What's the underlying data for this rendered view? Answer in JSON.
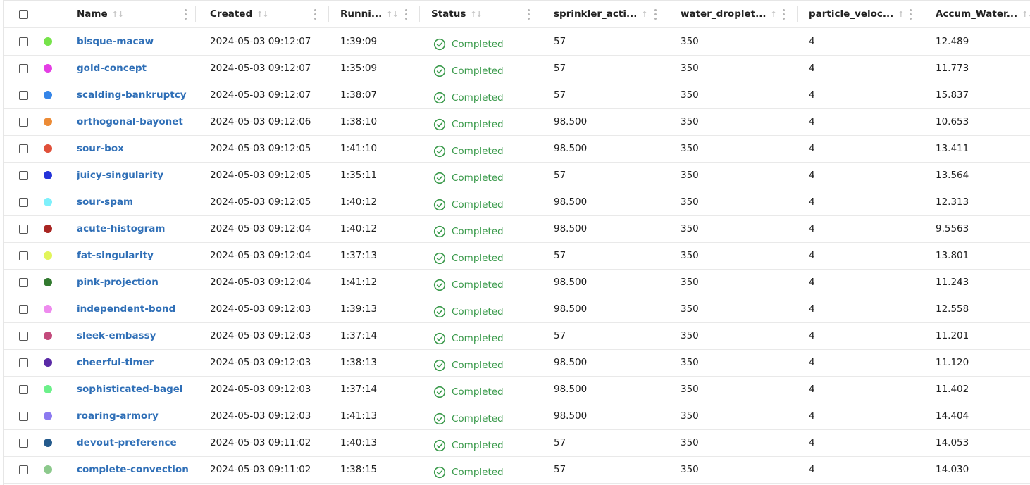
{
  "columns": {
    "name": "Name",
    "created": "Created",
    "running": "Runni...",
    "status": "Status",
    "sprinkler": "sprinkler_acti...",
    "water": "water_droplet...",
    "particle": "particle_veloc...",
    "accum": "Accum_Water..."
  },
  "icons": {
    "sort": "sort-icon",
    "menu": "column-menu-icon",
    "status": "check-circle-icon"
  },
  "colors": {
    "link": "#2f6fb7",
    "status_completed": "#3a9a4b"
  },
  "rows": [
    {
      "color": "#76e34a",
      "name": "bisque-macaw",
      "created": "2024-05-03 09:12:07",
      "running": "1:39:09",
      "status": "Completed",
      "sprinkler": "57",
      "water": "350",
      "particle": "4",
      "accum": "12.489"
    },
    {
      "color": "#e43ee4",
      "name": "gold-concept",
      "created": "2024-05-03 09:12:07",
      "running": "1:35:09",
      "status": "Completed",
      "sprinkler": "57",
      "water": "350",
      "particle": "4",
      "accum": "11.773"
    },
    {
      "color": "#3585e8",
      "name": "scalding-bankruptcy",
      "created": "2024-05-03 09:12:07",
      "running": "1:38:07",
      "status": "Completed",
      "sprinkler": "57",
      "water": "350",
      "particle": "4",
      "accum": "15.837"
    },
    {
      "color": "#ec8b36",
      "name": "orthogonal-bayonet",
      "created": "2024-05-03 09:12:06",
      "running": "1:38:10",
      "status": "Completed",
      "sprinkler": "98.500",
      "water": "350",
      "particle": "4",
      "accum": "10.653"
    },
    {
      "color": "#e0503a",
      "name": "sour-box",
      "created": "2024-05-03 09:12:05",
      "running": "1:41:10",
      "status": "Completed",
      "sprinkler": "98.500",
      "water": "350",
      "particle": "4",
      "accum": "13.411"
    },
    {
      "color": "#2433d9",
      "name": "juicy-singularity",
      "created": "2024-05-03 09:12:05",
      "running": "1:35:11",
      "status": "Completed",
      "sprinkler": "57",
      "water": "350",
      "particle": "4",
      "accum": "13.564"
    },
    {
      "color": "#7ef0fb",
      "name": "sour-spam",
      "created": "2024-05-03 09:12:05",
      "running": "1:40:12",
      "status": "Completed",
      "sprinkler": "98.500",
      "water": "350",
      "particle": "4",
      "accum": "12.313"
    },
    {
      "color": "#a82522",
      "name": "acute-histogram",
      "created": "2024-05-03 09:12:04",
      "running": "1:40:12",
      "status": "Completed",
      "sprinkler": "98.500",
      "water": "350",
      "particle": "4",
      "accum": "9.5563"
    },
    {
      "color": "#e2f55a",
      "name": "fat-singularity",
      "created": "2024-05-03 09:12:04",
      "running": "1:37:13",
      "status": "Completed",
      "sprinkler": "57",
      "water": "350",
      "particle": "4",
      "accum": "13.801"
    },
    {
      "color": "#327a2f",
      "name": "pink-projection",
      "created": "2024-05-03 09:12:04",
      "running": "1:41:12",
      "status": "Completed",
      "sprinkler": "98.500",
      "water": "350",
      "particle": "4",
      "accum": "11.243"
    },
    {
      "color": "#ee8bee",
      "name": "independent-bond",
      "created": "2024-05-03 09:12:03",
      "running": "1:39:13",
      "status": "Completed",
      "sprinkler": "98.500",
      "water": "350",
      "particle": "4",
      "accum": "12.558"
    },
    {
      "color": "#c34a7c",
      "name": "sleek-embassy",
      "created": "2024-05-03 09:12:03",
      "running": "1:37:14",
      "status": "Completed",
      "sprinkler": "57",
      "water": "350",
      "particle": "4",
      "accum": "11.201"
    },
    {
      "color": "#5a2aa6",
      "name": "cheerful-timer",
      "created": "2024-05-03 09:12:03",
      "running": "1:38:13",
      "status": "Completed",
      "sprinkler": "98.500",
      "water": "350",
      "particle": "4",
      "accum": "11.120"
    },
    {
      "color": "#6cf08a",
      "name": "sophisticated-bagel",
      "created": "2024-05-03 09:12:03",
      "running": "1:37:14",
      "status": "Completed",
      "sprinkler": "98.500",
      "water": "350",
      "particle": "4",
      "accum": "11.402"
    },
    {
      "color": "#8c7af0",
      "name": "roaring-armory",
      "created": "2024-05-03 09:12:03",
      "running": "1:41:13",
      "status": "Completed",
      "sprinkler": "98.500",
      "water": "350",
      "particle": "4",
      "accum": "14.404"
    },
    {
      "color": "#245a8c",
      "name": "devout-preference",
      "created": "2024-05-03 09:11:02",
      "running": "1:40:13",
      "status": "Completed",
      "sprinkler": "57",
      "water": "350",
      "particle": "4",
      "accum": "14.053"
    },
    {
      "color": "#8cc98c",
      "name": "complete-convection",
      "created": "2024-05-03 09:11:02",
      "running": "1:38:15",
      "status": "Completed",
      "sprinkler": "57",
      "water": "350",
      "particle": "4",
      "accum": "14.030"
    }
  ]
}
